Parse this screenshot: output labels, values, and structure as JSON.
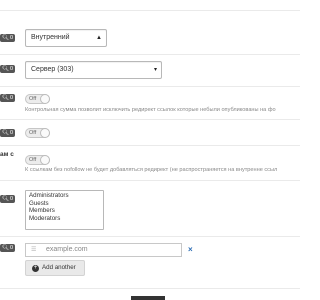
{
  "badges": {
    "zoom_label": "0",
    "magnifier_icon": "magnifier-icon"
  },
  "field_internal": {
    "selected": "Внутренний",
    "caret_icon": "chevron-down-icon"
  },
  "field_redirect_code": {
    "selected": "Сервер (303)",
    "caret_icon": "chevron-down-icon"
  },
  "toggle_checksum": {
    "state": "Off",
    "help": "Контрольная сумма позволит исключить редирект ссылок которые небыли опубликованы на фо"
  },
  "toggle_plain": {
    "state": "Off"
  },
  "toggle_nofollow": {
    "row_label": "ам с",
    "state": "Off",
    "help": "К ссылкам без nofollow не будет добавляться редирект (не распространяется на внутренне ссыл"
  },
  "groups": {
    "options": [
      "Administrators",
      "Guests",
      "Members",
      "Moderators"
    ]
  },
  "exclusions": {
    "placeholder": "example.com",
    "remove_label": "×",
    "add_label": "Add another"
  },
  "colors": {
    "accent": "#2a6bb3",
    "badge_bg": "#555555"
  }
}
